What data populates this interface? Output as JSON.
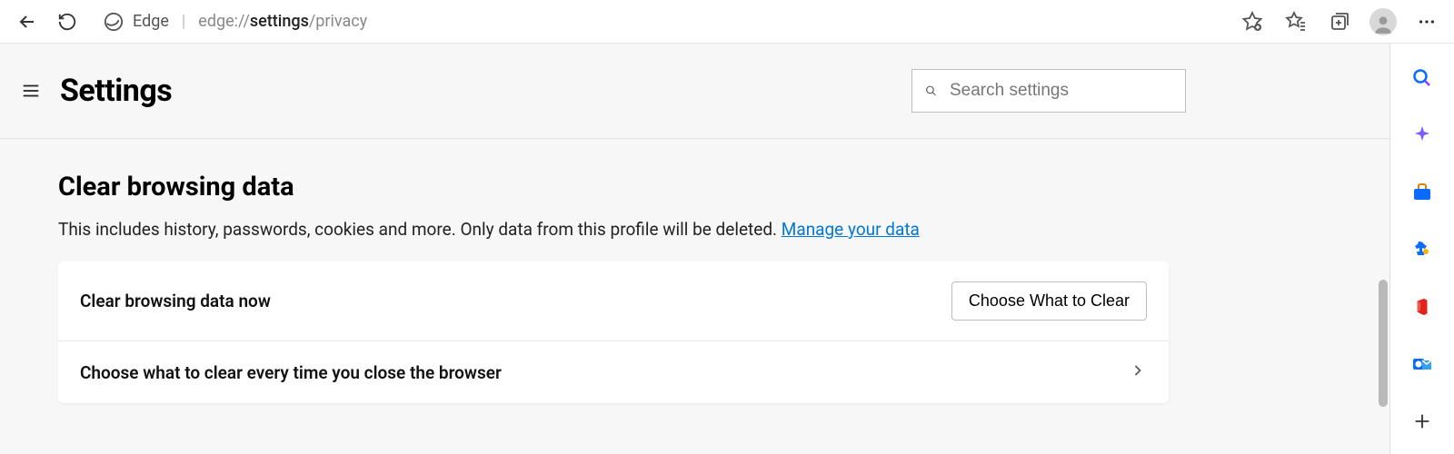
{
  "chrome": {
    "origin_label": "Edge",
    "url_prefix": "edge://",
    "url_bold": "settings",
    "url_suffix": "/privacy"
  },
  "header": {
    "title": "Settings",
    "search_placeholder": "Search settings"
  },
  "section": {
    "title": "Clear browsing data",
    "description": "This includes history, passwords, cookies and more. Only data from this profile will be deleted. ",
    "link_text": "Manage your data"
  },
  "rows": {
    "now_label": "Clear browsing data now",
    "now_button": "Choose What to Clear",
    "on_close_label": "Choose what to clear every time you close the browser"
  }
}
